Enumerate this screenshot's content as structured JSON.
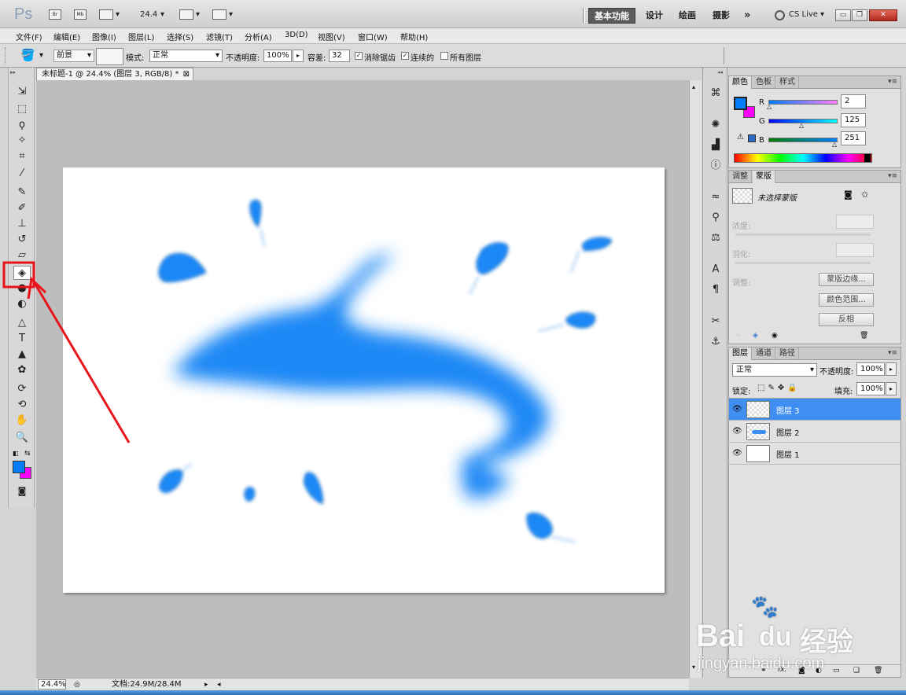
{
  "app": {
    "logo": "Ps",
    "bridge": "Br",
    "minibridge": "Mb",
    "zoom": "24.4"
  },
  "workspace": {
    "active": "基本功能",
    "items": [
      "设计",
      "绘画",
      "摄影"
    ],
    "more": "»",
    "cslive": "CS Live"
  },
  "menu": [
    "文件(F)",
    "编辑(E)",
    "图像(I)",
    "图层(L)",
    "选择(S)",
    "滤镜(T)",
    "分析(A)",
    "3D(D)",
    "视图(V)",
    "窗口(W)",
    "帮助(H)"
  ],
  "options": {
    "fill_source": "前景",
    "mode_label": "模式:",
    "mode_value": "正常",
    "opacity_label": "不透明度:",
    "opacity_value": "100%",
    "tolerance_label": "容差:",
    "tolerance_value": "32",
    "antialias": {
      "label": "消除锯齿",
      "checked": true
    },
    "contiguous": {
      "label": "连续的",
      "checked": true
    },
    "all_layers": {
      "label": "所有图层",
      "checked": false
    }
  },
  "document": {
    "tab_title": "未标题-1 @ 24.4% (图层 3, RGB/8) *",
    "close": "⊠"
  },
  "status": {
    "zoom": "24.4%",
    "doc_info": "文档:24.9M/28.4M"
  },
  "color_panel": {
    "tabs": [
      "颜色",
      "色板",
      "样式"
    ],
    "r": {
      "label": "R",
      "value": "2"
    },
    "g": {
      "label": "G",
      "value": "125"
    },
    "b": {
      "label": "B",
      "value": "251"
    },
    "fg": "#027dfb",
    "bg": "#ff00ff"
  },
  "mask_panel": {
    "tabs": [
      "调整",
      "蒙版"
    ],
    "status": "未选择蒙版",
    "density": "浓度:",
    "feather": "羽化:",
    "refine": "调整:",
    "buttons": [
      "蒙版边缘...",
      "颜色范围...",
      "反相"
    ]
  },
  "layers_panel": {
    "tabs": [
      "图层",
      "通道",
      "路径"
    ],
    "blend": "正常",
    "opacity_label": "不透明度:",
    "opacity_value": "100%",
    "lock_label": "锁定:",
    "fill_label": "填充:",
    "fill_value": "100%",
    "layers": [
      {
        "name": "图层 3",
        "selected": true
      },
      {
        "name": "图层 2",
        "selected": false
      },
      {
        "name": "图层 1",
        "selected": false
      }
    ]
  },
  "watermark": {
    "brand": "Bai",
    "brand2": "du",
    "cn": "经验",
    "url": "jingyan.baidu.com"
  },
  "highlight_color": "#e8141b",
  "selection_color": "#3f8ff2"
}
